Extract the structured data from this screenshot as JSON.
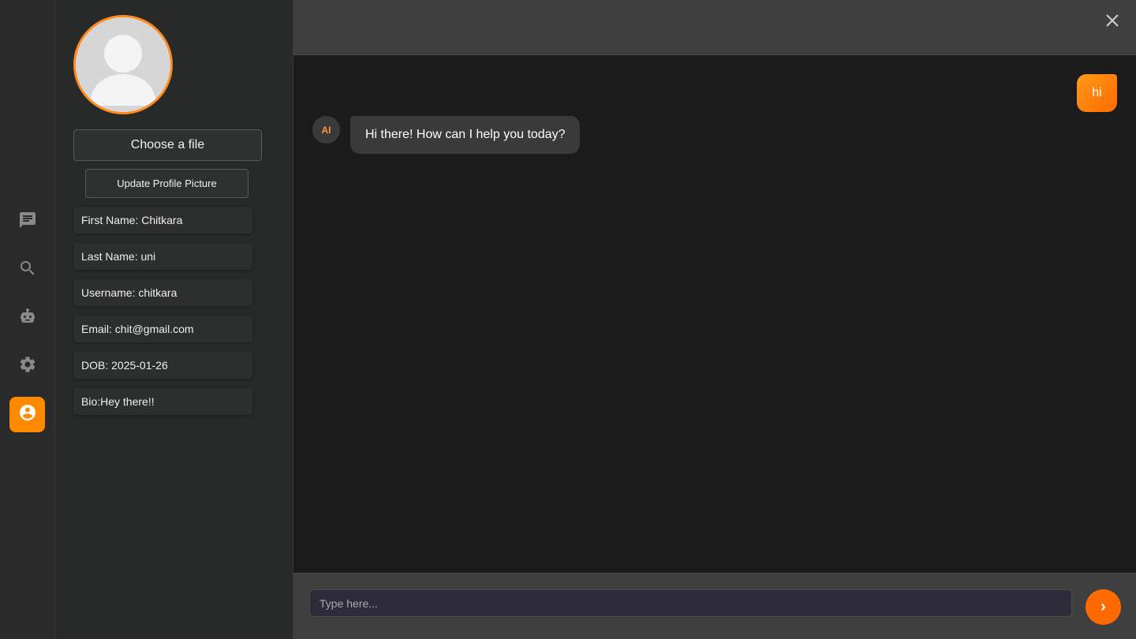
{
  "rail": {
    "items": [
      {
        "name": "chat",
        "icon": "chat-icon"
      },
      {
        "name": "search",
        "icon": "search-icon"
      },
      {
        "name": "bot",
        "icon": "robot-icon"
      },
      {
        "name": "settings",
        "icon": "gear-icon"
      },
      {
        "name": "profile",
        "icon": "account-circle-icon",
        "active": true
      }
    ]
  },
  "profile": {
    "avatar_icon": "user-avatar-placeholder",
    "choose_file_label": "Choose a file",
    "update_button_label": "Update Profile Picture",
    "fields": [
      {
        "text": "First Name: Chitkara"
      },
      {
        "text": "Last Name: uni"
      },
      {
        "text": "Username: chitkara"
      },
      {
        "text": "Email: chit@gmail.com"
      },
      {
        "text": "DOB: 2025-01-26"
      },
      {
        "text": "Bio:Hey there!!"
      }
    ]
  },
  "chat": {
    "close_icon": "close-icon",
    "messages": [
      {
        "role": "user",
        "text": "hi"
      },
      {
        "role": "ai",
        "avatar_label": "AI",
        "text": "Hi there! How can I help you today?"
      }
    ],
    "input": {
      "placeholder": "Type here...",
      "value": ""
    },
    "send_label": "›"
  },
  "colors": {
    "accent": "#ff8a00",
    "send": "#ff6a00",
    "background": "#1b1b1b",
    "panel": "#282a29",
    "header": "#3f3f3f"
  }
}
